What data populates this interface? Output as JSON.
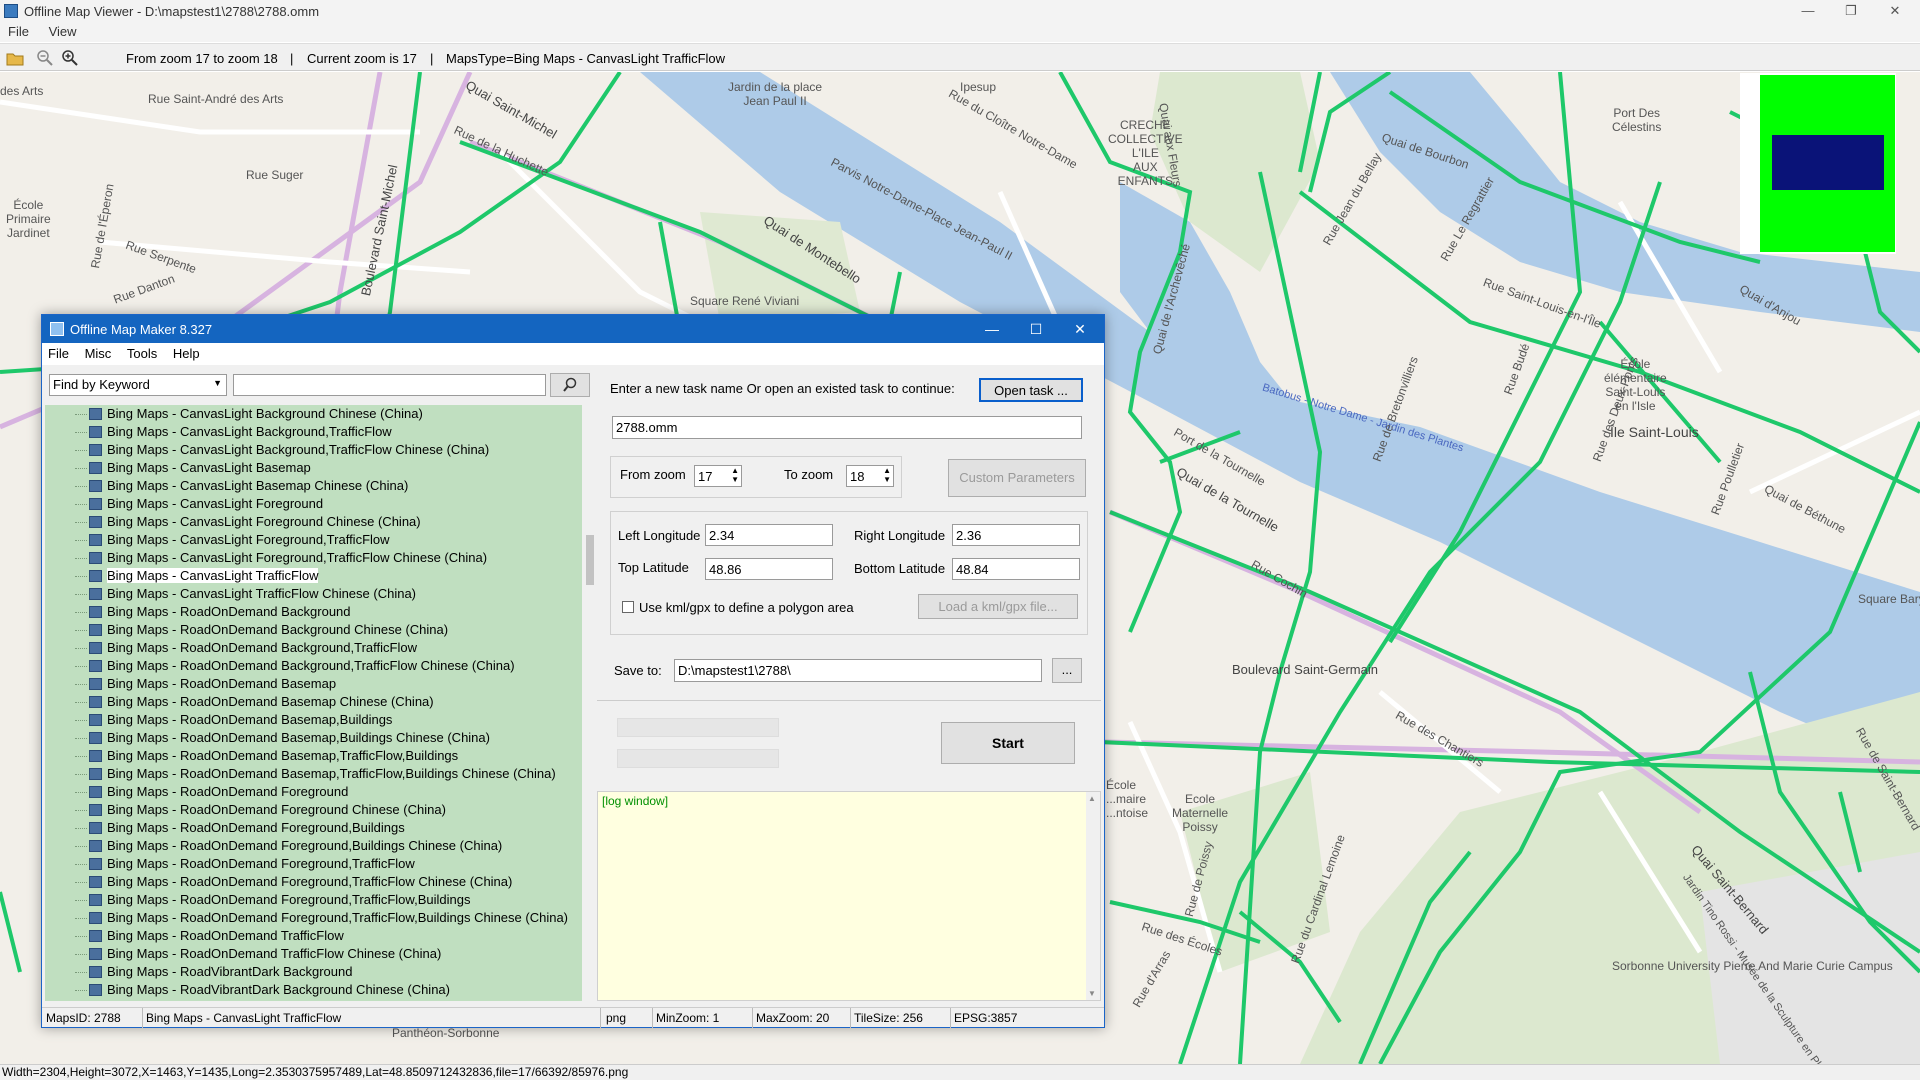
{
  "viewer": {
    "title": "Offline Map Viewer - D:\\mapstest1\\2788\\2788.omm",
    "menu": [
      "File",
      "View"
    ],
    "toolbar": {
      "zoom_range": "From zoom 17 to zoom 18",
      "current_zoom": "Current zoom is 17",
      "maps_type": "MapsType=Bing Maps - CanvasLight TrafficFlow",
      "sep": "|"
    },
    "status": "Width=2304,Height=3072,X=1463,Y=1435,Long=2.3530375957489,Lat=48.8509712432836,file=17/66392/85976.png"
  },
  "map_labels": {
    "quai_saint_michel": "Quai Saint-Michel",
    "rue_saint_andre": "Rue Saint-André des Arts",
    "rue_suger": "Rue Suger",
    "ecole_primaire": "École\nPrimaire\nJardinet",
    "rue_eperon": "Rue de l'Éperon",
    "rue_serpente": "Rue Serpente",
    "rue_danton": "Rue Danton",
    "bd_saint_michel": "Boulevard Saint-Michel",
    "rue_huchette": "Rue de la Huchette",
    "jardin_place": "Jardin de la place\nJean Paul II",
    "ipesup": "Ipesup",
    "rue_cloitre": "Rue du Cloître Notre-Dame",
    "creche": "CRECHE\nCOLLECTIVE\nL'ILE\nAUX\nENFANTS",
    "square_viviani": "Square René Viviani",
    "quai_montebello": "Quai de Montebello",
    "parvis": "Parvis Notre-Dame-Place Jean-Paul II",
    "quai_fleurs": "Quai aux Fleurs",
    "quai_archeveche": "Quai de l'Archevêché",
    "port_celestins": "Port Des\nCélestins",
    "quai_bourbon": "Quai de Bourbon",
    "rue_jean_bellay": "Rue Jean du Bellay",
    "rue_regrattier": "Rue Le Regrattier",
    "rue_st_louis": "Rue Saint-Louis-en-l'Île",
    "ecole_ile": "École\nélémentaire\nSaint-Louis\nen l'Isle",
    "ile_saint_louis": "Île Saint-Louis",
    "batobus": "Batobus - Notre Dame - Jardin des Plantes",
    "quai_tournelle": "Quai de la Tournelle",
    "port_tournelle": "Port de la Tournelle",
    "bd_st_germain": "Boulevard Saint-Germain",
    "rue_cochin": "Rue Cochin",
    "square_barye": "Square Barye",
    "rue_chantiers": "Rue des Chantiers",
    "ecole_maternelle": "Ecole\nMaternelle\nPoissy",
    "rue_poissy": "Rue de Poissy",
    "rue_cardinal": "Rue du Cardinal Lemoine",
    "sorbonne": "Sorbonne University Pierre And Marie Curie Campus",
    "pantheon": "Panthéon-Sorbonne",
    "rue_ecoles": "Rue des Écoles",
    "rue_arras": "Rue d'Arras",
    "jardin_tino": "Jardin Tino Rossi - Musée de la Sculpture en Plein Air",
    "quai_anjou": "Quai d'Anjou",
    "rue_bude": "Rue Budé",
    "rue_deux_ponts": "Rue des Deux-Ponts",
    "rue_bretonvilliers": "Rue de Bretonvilliers",
    "rue_poulletier": "Rue Poulletier",
    "quai_bethune": "Quai de Béthune",
    "rue_st_bernard": "Rue de Saint-Bernard",
    "quai_st_bernard": "Quai Saint-Bernard",
    "ecole_pontoise": "École\n...maire\n...ntoise"
  },
  "dialog": {
    "title": "Offline Map Maker 8.327",
    "menu": [
      "File",
      "Misc",
      "Tools",
      "Help"
    ],
    "find_mode": "Find by Keyword",
    "search_value": "",
    "tree_items": [
      "Bing Maps - CanvasLight Background Chinese (China)",
      "Bing Maps - CanvasLight Background,TrafficFlow",
      "Bing Maps - CanvasLight Background,TrafficFlow Chinese (China)",
      "Bing Maps - CanvasLight Basemap",
      "Bing Maps - CanvasLight Basemap Chinese (China)",
      "Bing Maps - CanvasLight Foreground",
      "Bing Maps - CanvasLight Foreground Chinese (China)",
      "Bing Maps - CanvasLight Foreground,TrafficFlow",
      "Bing Maps - CanvasLight Foreground,TrafficFlow Chinese (China)",
      "Bing Maps - CanvasLight TrafficFlow",
      "Bing Maps - CanvasLight TrafficFlow Chinese (China)",
      "Bing Maps - RoadOnDemand Background",
      "Bing Maps - RoadOnDemand Background Chinese (China)",
      "Bing Maps - RoadOnDemand Background,TrafficFlow",
      "Bing Maps - RoadOnDemand Background,TrafficFlow Chinese (China)",
      "Bing Maps - RoadOnDemand Basemap",
      "Bing Maps - RoadOnDemand Basemap Chinese (China)",
      "Bing Maps - RoadOnDemand Basemap,Buildings",
      "Bing Maps - RoadOnDemand Basemap,Buildings Chinese (China)",
      "Bing Maps - RoadOnDemand Basemap,TrafficFlow,Buildings",
      "Bing Maps - RoadOnDemand Basemap,TrafficFlow,Buildings Chinese (China)",
      "Bing Maps - RoadOnDemand Foreground",
      "Bing Maps - RoadOnDemand Foreground Chinese (China)",
      "Bing Maps - RoadOnDemand Foreground,Buildings",
      "Bing Maps - RoadOnDemand Foreground,Buildings Chinese (China)",
      "Bing Maps - RoadOnDemand Foreground,TrafficFlow",
      "Bing Maps - RoadOnDemand Foreground,TrafficFlow Chinese (China)",
      "Bing Maps - RoadOnDemand Foreground,TrafficFlow,Buildings",
      "Bing Maps - RoadOnDemand Foreground,TrafficFlow,Buildings Chinese (China)",
      "Bing Maps - RoadOnDemand TrafficFlow",
      "Bing Maps - RoadOnDemand TrafficFlow Chinese (China)",
      "Bing Maps - RoadVibrantDark Background",
      "Bing Maps - RoadVibrantDark Background Chinese (China)"
    ],
    "selected_index": 9,
    "task_prompt": "Enter a new task name Or open an existed task to continue:",
    "open_task": "Open task ...",
    "task_name": "2788.omm",
    "from_zoom_label": "From zoom",
    "from_zoom": "17",
    "to_zoom_label": "To zoom",
    "to_zoom": "18",
    "custom_params": "Custom Parameters",
    "left_lon_label": "Left Longitude",
    "left_lon": "2.34",
    "right_lon_label": "Right Longitude",
    "right_lon": "2.36",
    "top_lat_label": "Top Latitude",
    "top_lat": "48.86",
    "bottom_lat_label": "Bottom Latitude",
    "bottom_lat": "48.84",
    "kml_label": "Use kml/gpx to define a polygon area",
    "load_kml": "Load a kml/gpx file...",
    "save_to_label": "Save to:",
    "save_to": "D:\\mapstest1\\2788\\",
    "browse": "...",
    "start": "Start",
    "log_title": "[log window]",
    "status": {
      "maps_id": "MapsID: 2788",
      "maps_name": "Bing Maps - CanvasLight TrafficFlow",
      "format": "png",
      "min_zoom": "MinZoom: 1",
      "max_zoom": "MaxZoom: 20",
      "tile_size": "TileSize: 256",
      "epsg": "EPSG:3857"
    }
  },
  "colors": {
    "title_bar": "#1465c0",
    "tree_bg": "#c0dfc0",
    "log_bg": "#ffffe0",
    "traffic": "#1ec86a",
    "river": "#aecbe8"
  }
}
